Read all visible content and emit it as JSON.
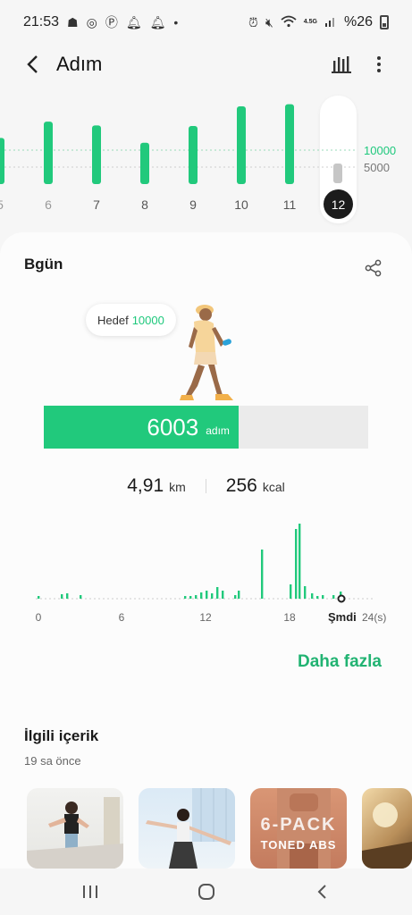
{
  "status_bar": {
    "time": "21:53",
    "battery": "%26",
    "network": "4.5G"
  },
  "header": {
    "title": "Adım"
  },
  "weekly": {
    "days": [
      {
        "label": "5",
        "steps": 8500
      },
      {
        "label": "6",
        "steps": 11500
      },
      {
        "label": "7",
        "steps": 10800
      },
      {
        "label": "8",
        "steps": 7600
      },
      {
        "label": "9",
        "steps": 10700
      },
      {
        "label": "10",
        "steps": 14300
      },
      {
        "label": "11",
        "steps": 14700
      },
      {
        "label": "12",
        "steps": 6003
      }
    ],
    "selected": "12",
    "goal_line_1": "10000",
    "goal_line_2": "5000"
  },
  "today": {
    "title": "Bgün",
    "goal_label": "Hedef",
    "goal_value": "10000",
    "steps": "6003",
    "steps_unit": "adım",
    "progress_fraction": 0.6003,
    "distance": "4,91",
    "distance_unit": "km",
    "calories": "256",
    "calories_unit": "kcal"
  },
  "hourly": {
    "x_labels": [
      "0",
      "6",
      "12",
      "18"
    ],
    "now_label": "Şmdi",
    "end_label": "24(s)"
  },
  "more_link": "Daha fazla",
  "related": {
    "title": "İlgili içerik",
    "time": "19 sa önce",
    "thumb3_line1": "6-PACK",
    "thumb3_line2": "TONED ABS"
  },
  "colors": {
    "accent": "#21c97c",
    "link": "#21b372"
  }
}
